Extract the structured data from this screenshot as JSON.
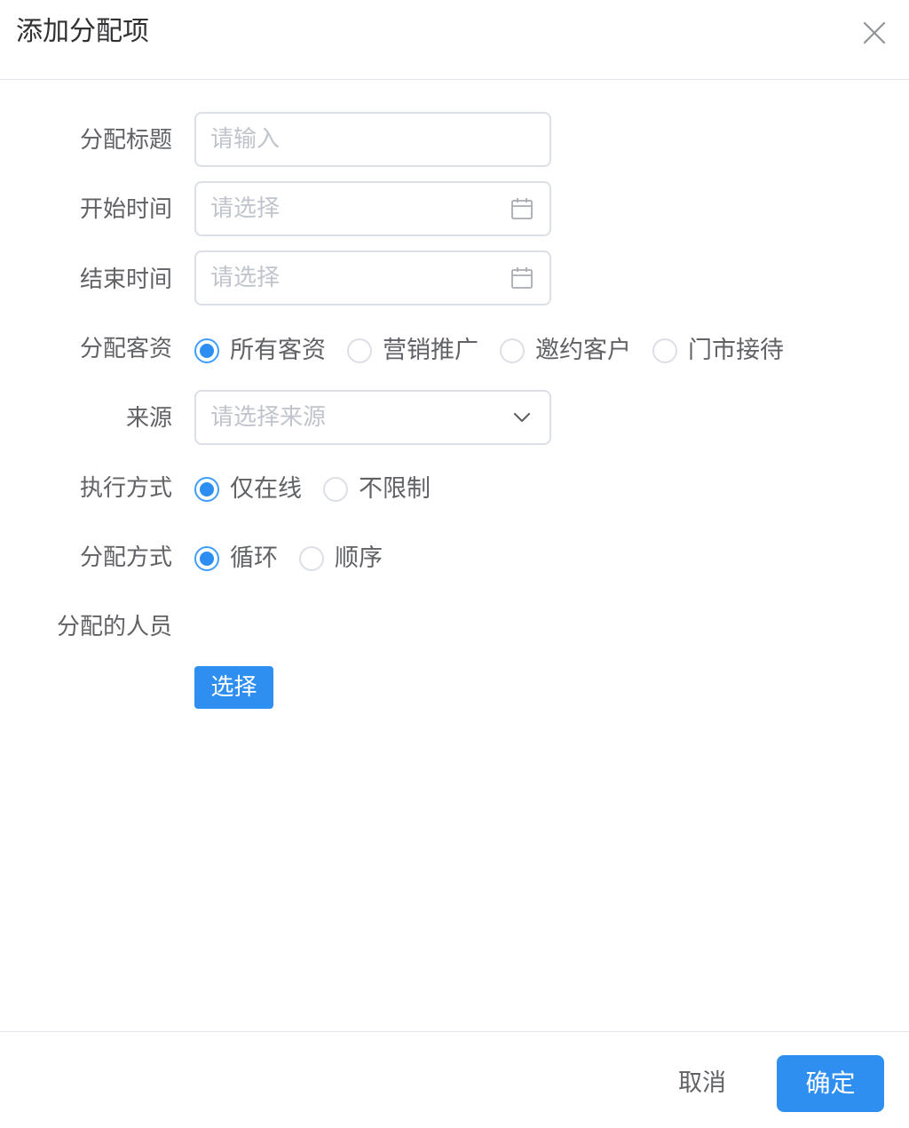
{
  "dialog": {
    "title": "添加分配项"
  },
  "form": {
    "title_label": "分配标题",
    "title_placeholder": "请输入",
    "start_label": "开始时间",
    "start_placeholder": "请选择",
    "end_label": "结束时间",
    "end_placeholder": "请选择",
    "customer_label": "分配客资",
    "customer_options": [
      "所有客资",
      "营销推广",
      "邀约客户",
      "门市接待"
    ],
    "customer_selected": "所有客资",
    "source_label": "来源",
    "source_placeholder": "请选择来源",
    "exec_label": "执行方式",
    "exec_options": [
      "仅在线",
      "不限制"
    ],
    "exec_selected": "仅在线",
    "method_label": "分配方式",
    "method_options": [
      "循环",
      "顺序"
    ],
    "method_selected": "循环",
    "people_label": "分配的人员",
    "select_button": "选择"
  },
  "footer": {
    "cancel": "取消",
    "confirm": "确定"
  },
  "colors": {
    "primary": "#2f8ff0",
    "border": "#dcdfe6",
    "placeholder": "#c0c4cc",
    "text": "#606266"
  },
  "icons": {
    "close": "close-icon",
    "calendar": "calendar-icon",
    "dropdown": "chevron-down-icon"
  }
}
